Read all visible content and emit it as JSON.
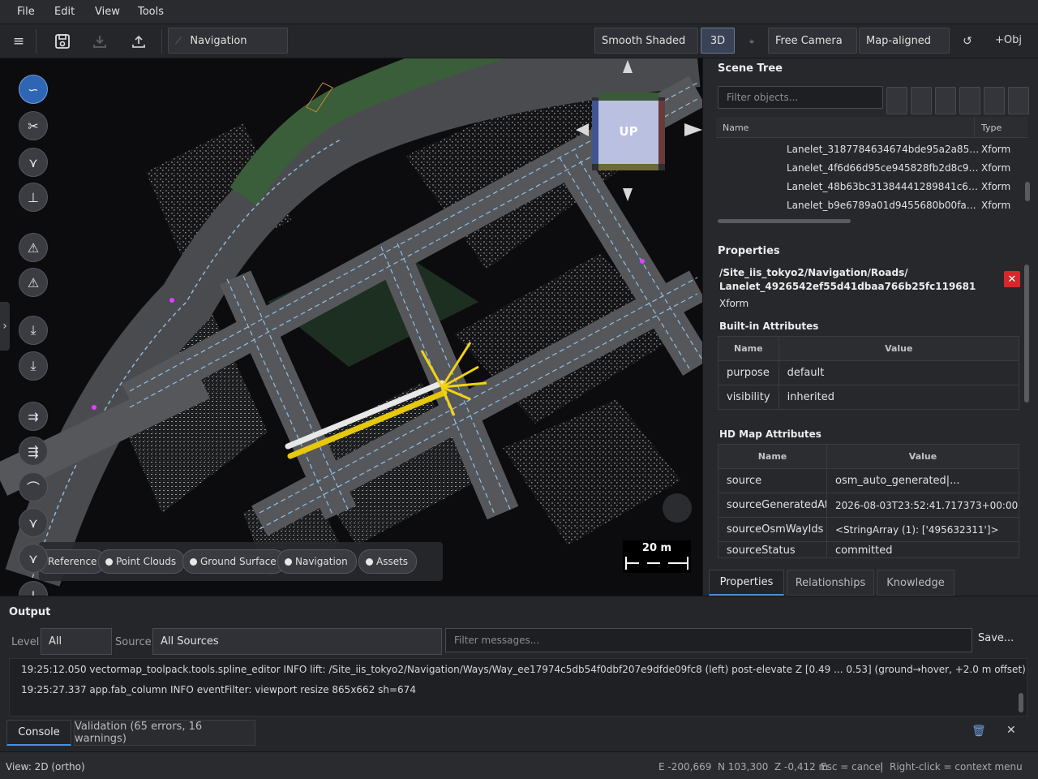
{
  "menu": [
    "File",
    "Edit",
    "View",
    "Tools"
  ],
  "toolbar": {
    "mode_label": "Navigation",
    "shading": "Smooth Shaded",
    "dim_toggle": "3D",
    "camera": "Free Camera",
    "alignment": "Map-aligned",
    "add_object": "+Obj"
  },
  "viewport": {
    "gizmo_label": "UP",
    "scale_label": "20 m",
    "layers": [
      {
        "label": "Reference"
      },
      {
        "label": "Point Clouds"
      },
      {
        "label": "Ground Surface"
      },
      {
        "label": "Navigation"
      },
      {
        "label": "Assets"
      }
    ]
  },
  "scene_tree": {
    "title": "Scene Tree",
    "filter_placeholder": "Filter objects...",
    "col_name": "Name",
    "col_type": "Type",
    "rows": [
      {
        "name": "Lanelet_3187784634674bde95a2a855...",
        "type": "Xform"
      },
      {
        "name": "Lanelet_4f6d66d95ce945828fb2d8c91...",
        "type": "Xform"
      },
      {
        "name": "Lanelet_48b63bc31384441289841c67...",
        "type": "Xform"
      },
      {
        "name": "Lanelet_b9e6789a01d9455680b00faa5...",
        "type": "Xform"
      }
    ]
  },
  "properties": {
    "title": "Properties",
    "path_line1": "/Site_iis_tokyo2/Navigation/Roads/",
    "path_line2": "Lanelet_4926542ef55d41dbaa766b25fc119681",
    "type": "Xform",
    "builtin_title": "Built-in Attributes",
    "builtin_cols": {
      "name": "Name",
      "value": "Value"
    },
    "builtin": [
      {
        "name": "purpose",
        "value": "default"
      },
      {
        "name": "visibility",
        "value": "inherited"
      }
    ],
    "hd_title": "HD Map Attributes",
    "hd_cols": {
      "name": "Name",
      "value": "Value"
    },
    "hd": [
      {
        "name": "source",
        "value": "osm_auto_generated|..."
      },
      {
        "name": "sourceGeneratedAt",
        "value": "2026-08-03T23:52:41.717373+00:00"
      },
      {
        "name": "sourceOsmWayIds",
        "value": "<StringArray (1): ['495632311']>"
      },
      {
        "name": "sourceStatus",
        "value": "committed"
      }
    ],
    "tabs": [
      "Properties",
      "Relationships",
      "Knowledge"
    ]
  },
  "output": {
    "title": "Output",
    "level_label": "Level:",
    "level_value": "All",
    "source_label": "Source:",
    "source_value": "All Sources",
    "filter_placeholder": "Filter messages...",
    "save_label": "Save...",
    "lines": [
      "19:25:12.050  vectormap_toolpack.tools.spline_editor INFO    lift: /Site_iis_tokyo2/Navigation/Ways/Way_ee17974c5db54f0dbf207e9dfde09fc8 (left) post-elevate Z [0.49 ... 0.53] (ground→hover, +2.0 m offset)",
      "19:25:27.337  app.fab_column        INFO    eventFilter: viewport resize 865x662 sh=674"
    ],
    "tabs": [
      "Console",
      "Validation (65 errors, 16 warnings)"
    ]
  },
  "status": {
    "view": "View: 2D (ortho)",
    "coords": "E -200,669  N 103,300  Z -0,412 m",
    "hint_cancel": "Esc = cancel",
    "hint_context": "Right-click = context menu"
  }
}
